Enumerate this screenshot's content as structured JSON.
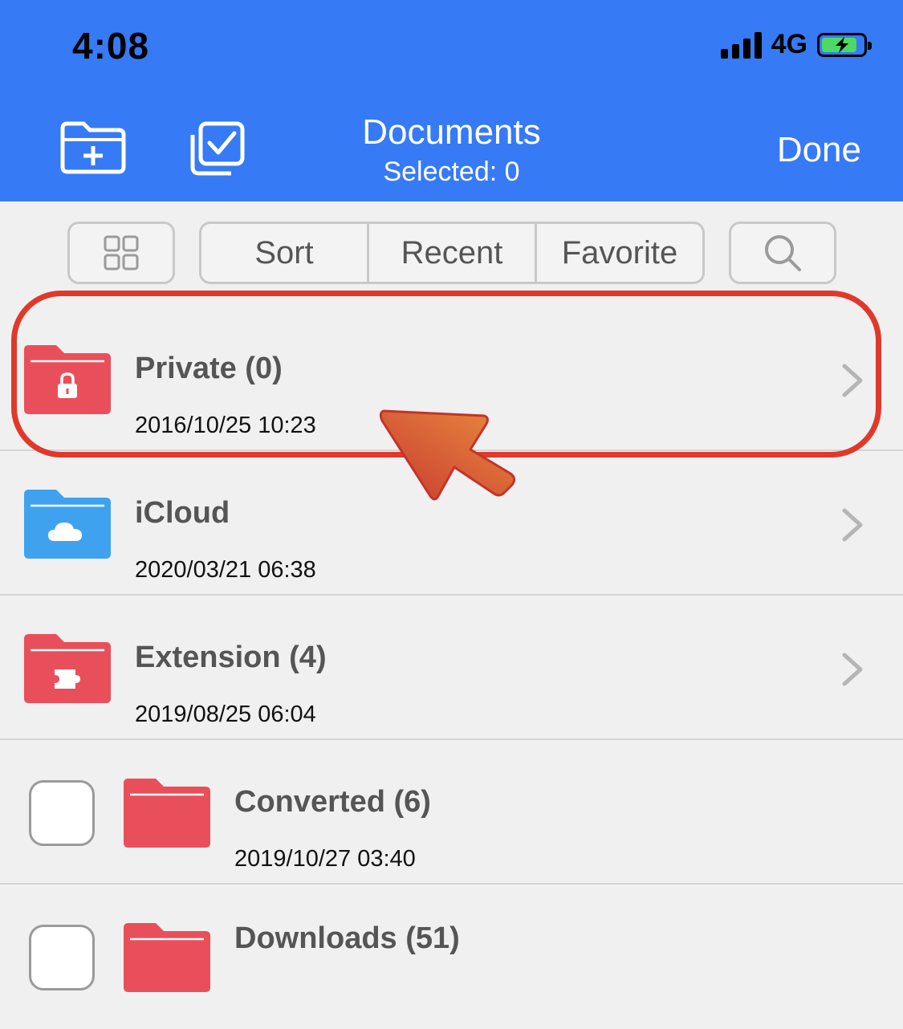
{
  "status_bar": {
    "time": "4:08",
    "network": "4G",
    "battery_level": 0.85
  },
  "nav": {
    "title": "Documents",
    "subtitle": "Selected: 0",
    "done_label": "Done",
    "icons": [
      "new-folder-icon",
      "select-all-icon"
    ]
  },
  "toolbar": {
    "segments": [
      "Sort",
      "Recent",
      "Favorite"
    ],
    "icons": [
      "grid-view-icon",
      "search-icon"
    ]
  },
  "folders": [
    {
      "name": "Private (0)",
      "date": "2016/10/25 10:23",
      "icon": "lock-icon",
      "color": "#e94f5a"
    },
    {
      "name": "iCloud",
      "date": "2020/03/21 06:38",
      "icon": "cloud-icon",
      "color": "#3fa2ef"
    },
    {
      "name": "Extension (4)",
      "date": "2019/08/25 06:04",
      "icon": "puzzle-icon",
      "color": "#e94f5a"
    },
    {
      "name": "Converted (6)",
      "date": "2019/10/27 03:40",
      "icon": "",
      "color": "#e94f5a"
    },
    {
      "name": "Downloads (51)",
      "date": "",
      "icon": "",
      "color": "#e94f5a"
    }
  ],
  "colors": {
    "header": "#367af6",
    "highlight": "#e0392b",
    "arrow": "#d9463a"
  }
}
